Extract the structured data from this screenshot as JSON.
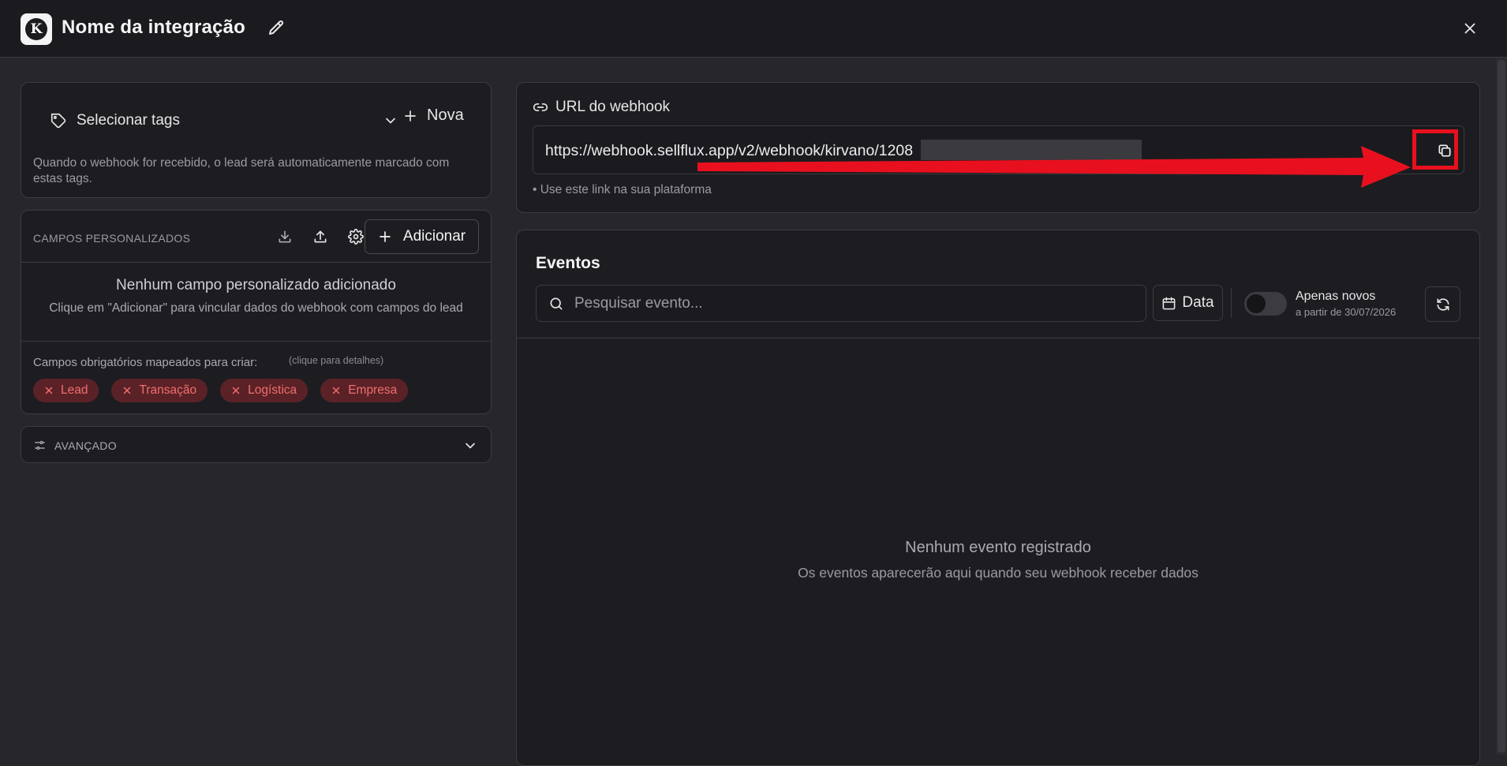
{
  "header": {
    "logo_letter": "K",
    "title": "Nome da integração",
    "edit_icon": "pencil-icon",
    "close_icon": "close-icon"
  },
  "tags": {
    "select_label": "Selecionar tags",
    "new_label": "Nova",
    "help": "Quando o webhook for recebido, o lead será automaticamente marcado com estas tags."
  },
  "campos": {
    "title": "CAMPOS PERSONALIZADOS",
    "add_label": "Adicionar",
    "empty_title": "Nenhum campo personalizado adicionado",
    "empty_sub": "Clique em \"Adicionar\" para vincular dados do webhook com campos do lead",
    "required_label": "Campos obrigatórios mapeados para criar:",
    "required_hint": "(clique para detalhes)",
    "required_chips": [
      "Lead",
      "Transação",
      "Logística",
      "Empresa"
    ]
  },
  "avancado": {
    "label": "AVANÇADO"
  },
  "webhook": {
    "title": "URL do webhook",
    "url": "https://webhook.sellflux.app/v2/webhook/kirvano/1208",
    "note": "• Use este link na sua plataforma"
  },
  "eventos": {
    "title": "Eventos",
    "search_placeholder": "Pesquisar evento...",
    "date_label": "Data",
    "only_new_label": "Apenas novos",
    "only_new_sub": "a partir de 30/07/2026",
    "only_new_on": false,
    "empty_title": "Nenhum evento registrado",
    "empty_sub": "Os eventos aparecerão aqui quando seu webhook receber dados"
  },
  "colors": {
    "background": "#27272b",
    "card": "#1d1d21",
    "chip_bg": "#5a2227",
    "chip_text": "#f26d6d",
    "annotation_red": "#e8101e"
  }
}
